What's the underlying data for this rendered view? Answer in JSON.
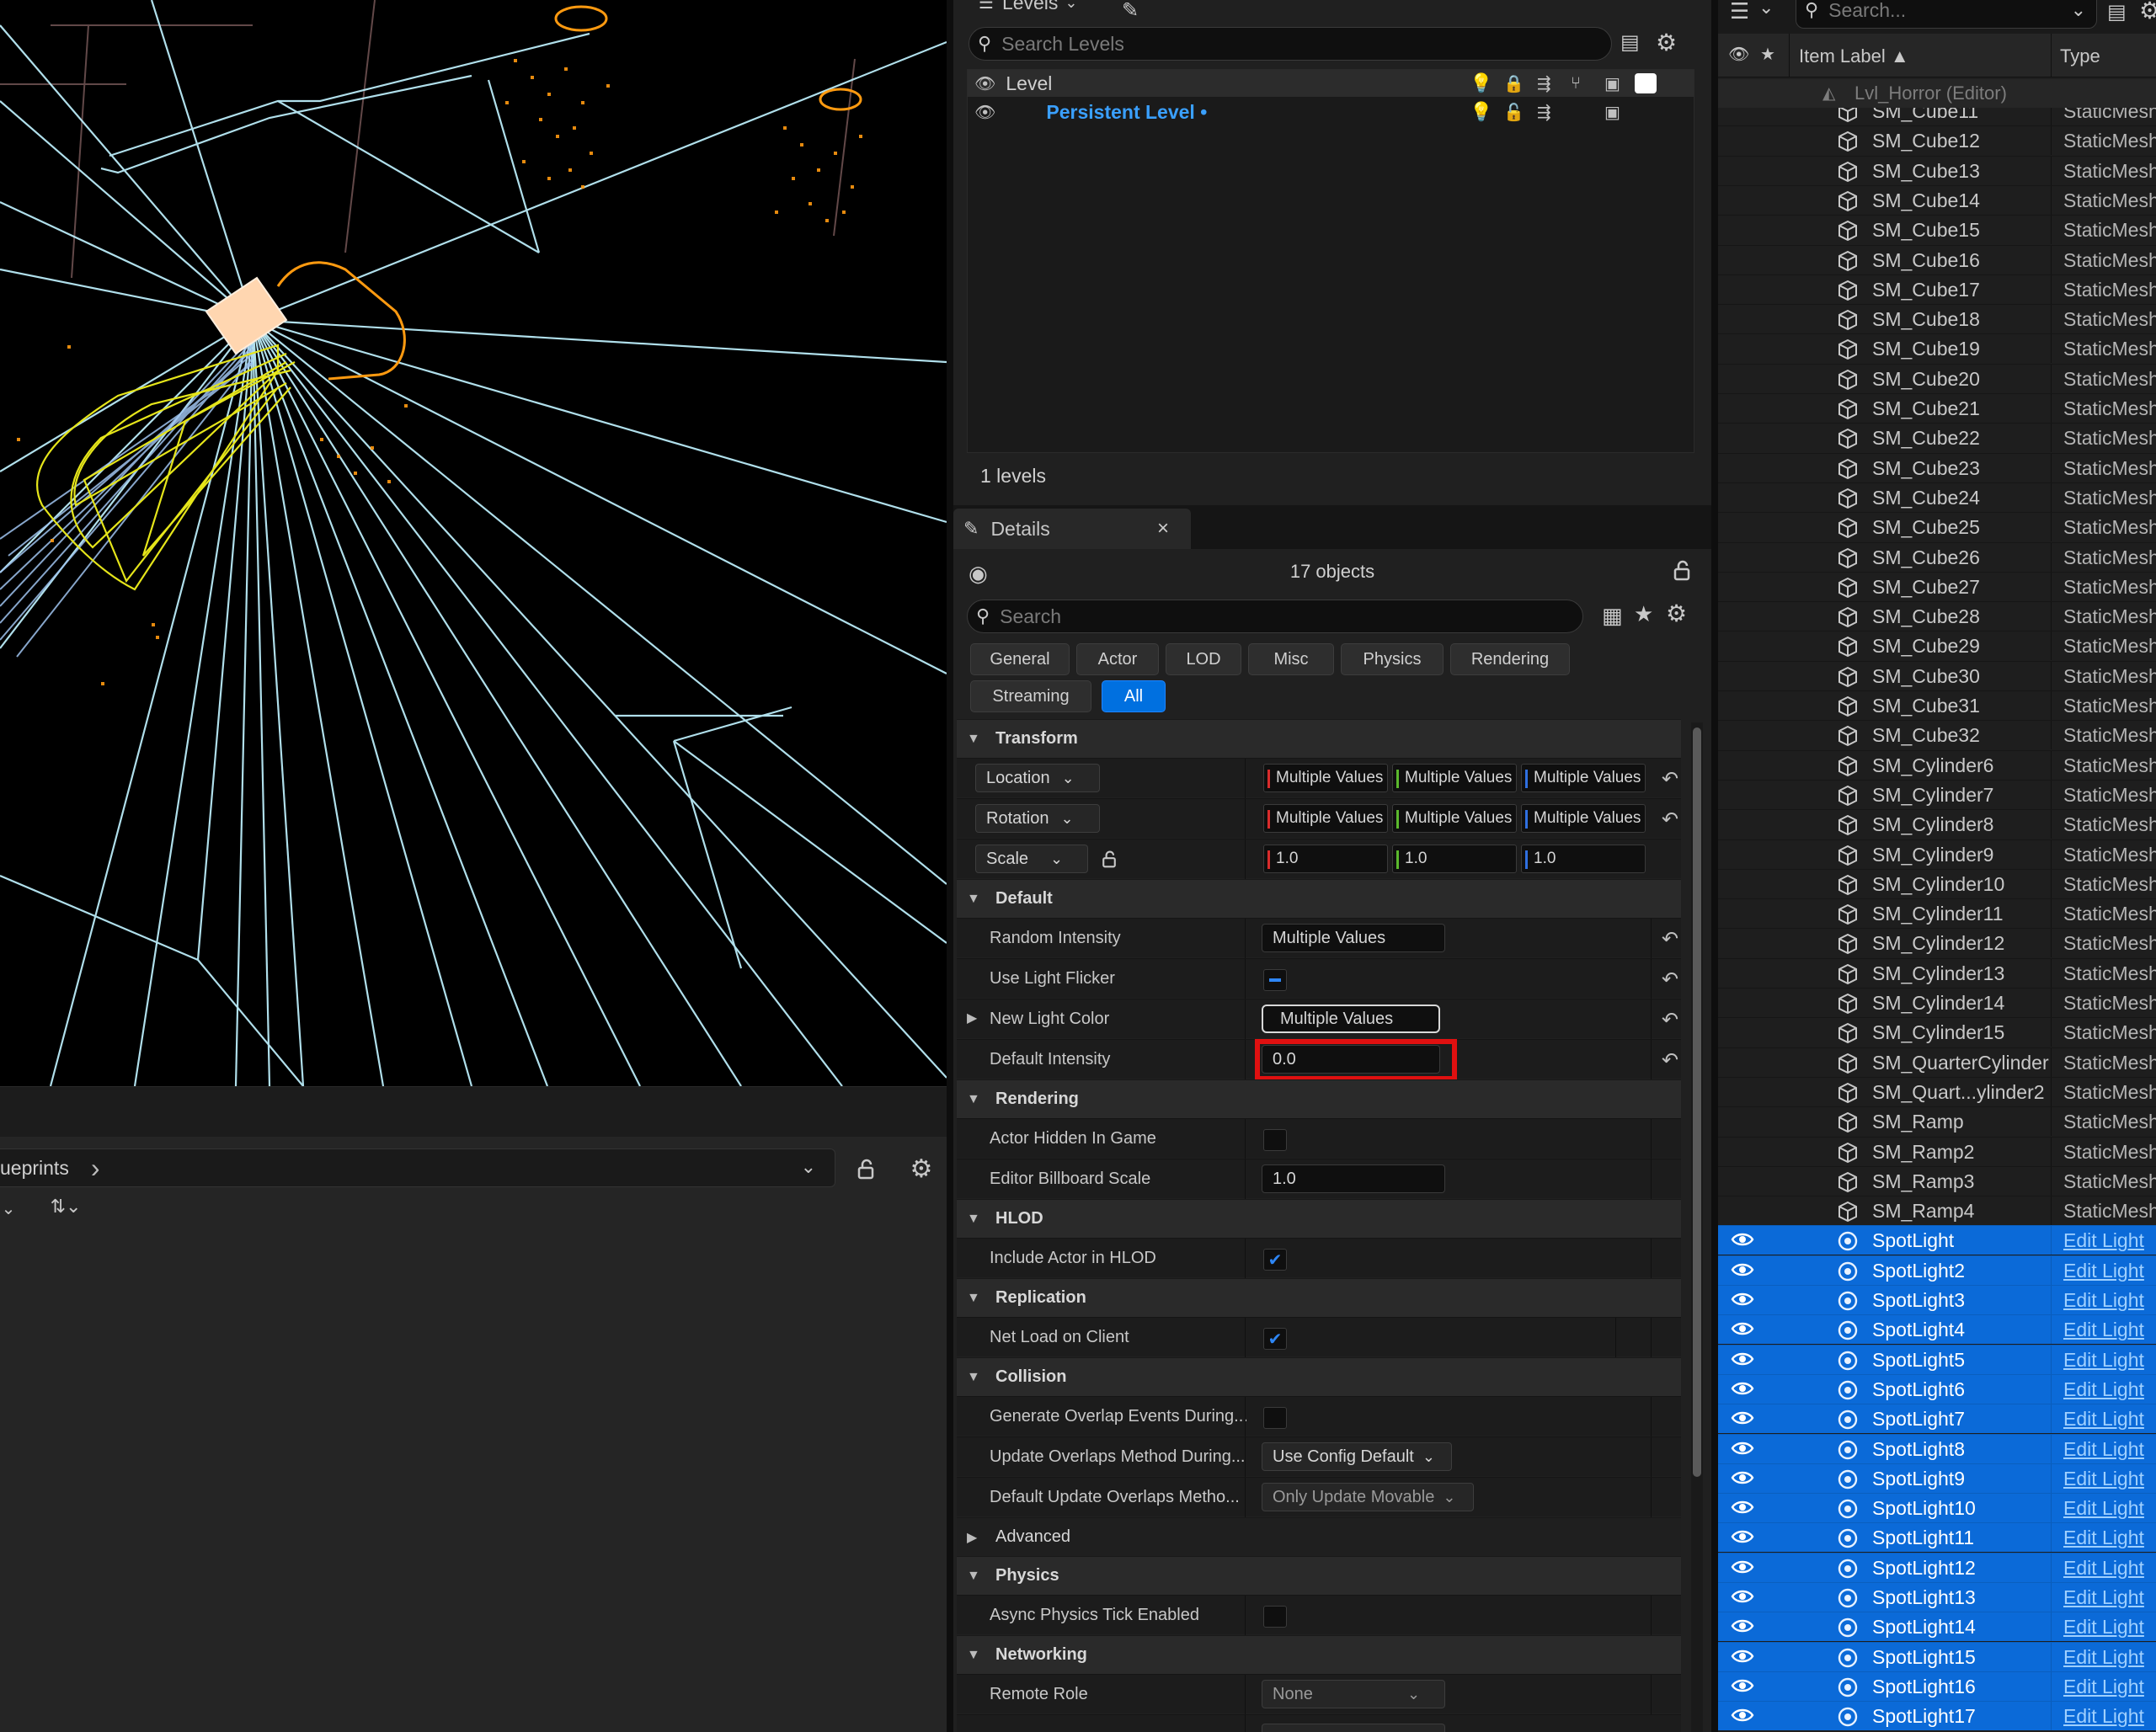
{
  "viewport": {
    "name": "3D viewport (wireframe lights)"
  },
  "content_browser": {
    "path_label": "ueprints",
    "path_chevron": "›"
  },
  "levels": {
    "tab_label": "Levels",
    "search_placeholder": "Search Levels",
    "column_label": "Level",
    "persistent_level": "Persistent Level •",
    "count": "1 levels"
  },
  "details": {
    "tab_label": "Details",
    "close_glyph": "×",
    "objects_count": "17 objects",
    "search_placeholder": "Search",
    "filter_tabs": [
      "General",
      "Actor",
      "LOD",
      "Misc",
      "Physics",
      "Rendering",
      "Streaming",
      "All"
    ],
    "active_filter": "All",
    "sections": {
      "transform": "Transform",
      "default": "Default",
      "rendering": "Rendering",
      "hlod": "HLOD",
      "replication": "Replication",
      "collision": "Collision",
      "advanced": "Advanced",
      "physics": "Physics",
      "networking": "Networking"
    },
    "transform": {
      "location_label": "Location",
      "rotation_label": "Rotation",
      "scale_label": "Scale",
      "location": [
        "Multiple Values",
        "Multiple Values",
        "Multiple Values"
      ],
      "rotation": [
        "Multiple Values",
        "Multiple Values",
        "Multiple Values"
      ],
      "scale": [
        "1.0",
        "1.0",
        "1.0"
      ]
    },
    "default": {
      "random_intensity_label": "Random Intensity",
      "random_intensity_value": "Multiple Values",
      "use_light_flicker_label": "Use Light Flicker",
      "new_light_color_label": "New Light Color",
      "new_light_color_value": "Multiple Values",
      "default_intensity_label": "Default Intensity",
      "default_intensity_value": "0.0"
    },
    "rendering": {
      "actor_hidden_label": "Actor Hidden In Game",
      "billboard_scale_label": "Editor Billboard Scale",
      "billboard_scale_value": "1.0"
    },
    "hlod": {
      "include_label": "Include Actor in HLOD"
    },
    "replication": {
      "net_load_label": "Net Load on Client"
    },
    "collision": {
      "generate_overlap_label": "Generate Overlap Events During...",
      "update_overlaps_label": "Update Overlaps Method During...",
      "update_overlaps_value": "Use Config Default",
      "default_update_label": "Default Update Overlaps Metho...",
      "default_update_value": "Only Update Movable"
    },
    "physics": {
      "async_tick_label": "Async Physics Tick Enabled"
    },
    "networking": {
      "remote_role_label": "Remote Role",
      "remote_role_value": "None"
    }
  },
  "outliner": {
    "search_placeholder": "Search...",
    "col_label": "Item Label ▲",
    "col_type": "Type",
    "root_item": "Lvl_Horror (Editor)",
    "rows": [
      {
        "name": "SM_Cube11",
        "type": "StaticMesh"
      },
      {
        "name": "SM_Cube12",
        "type": "StaticMesh"
      },
      {
        "name": "SM_Cube13",
        "type": "StaticMesh"
      },
      {
        "name": "SM_Cube14",
        "type": "StaticMesh"
      },
      {
        "name": "SM_Cube15",
        "type": "StaticMesh"
      },
      {
        "name": "SM_Cube16",
        "type": "StaticMesh"
      },
      {
        "name": "SM_Cube17",
        "type": "StaticMesh"
      },
      {
        "name": "SM_Cube18",
        "type": "StaticMesh"
      },
      {
        "name": "SM_Cube19",
        "type": "StaticMesh"
      },
      {
        "name": "SM_Cube20",
        "type": "StaticMesh"
      },
      {
        "name": "SM_Cube21",
        "type": "StaticMesh"
      },
      {
        "name": "SM_Cube22",
        "type": "StaticMesh"
      },
      {
        "name": "SM_Cube23",
        "type": "StaticMesh"
      },
      {
        "name": "SM_Cube24",
        "type": "StaticMesh"
      },
      {
        "name": "SM_Cube25",
        "type": "StaticMesh"
      },
      {
        "name": "SM_Cube26",
        "type": "StaticMesh"
      },
      {
        "name": "SM_Cube27",
        "type": "StaticMesh"
      },
      {
        "name": "SM_Cube28",
        "type": "StaticMesh"
      },
      {
        "name": "SM_Cube29",
        "type": "StaticMesh"
      },
      {
        "name": "SM_Cube30",
        "type": "StaticMesh"
      },
      {
        "name": "SM_Cube31",
        "type": "StaticMesh"
      },
      {
        "name": "SM_Cube32",
        "type": "StaticMesh"
      },
      {
        "name": "SM_Cylinder6",
        "type": "StaticMesh"
      },
      {
        "name": "SM_Cylinder7",
        "type": "StaticMesh"
      },
      {
        "name": "SM_Cylinder8",
        "type": "StaticMesh"
      },
      {
        "name": "SM_Cylinder9",
        "type": "StaticMesh"
      },
      {
        "name": "SM_Cylinder10",
        "type": "StaticMesh"
      },
      {
        "name": "SM_Cylinder11",
        "type": "StaticMesh"
      },
      {
        "name": "SM_Cylinder12",
        "type": "StaticMesh"
      },
      {
        "name": "SM_Cylinder13",
        "type": "StaticMesh"
      },
      {
        "name": "SM_Cylinder14",
        "type": "StaticMesh"
      },
      {
        "name": "SM_Cylinder15",
        "type": "StaticMesh"
      },
      {
        "name": "SM_QuarterCylinder",
        "type": "StaticMesh"
      },
      {
        "name": "SM_Quart...ylinder2",
        "type": "StaticMesh"
      },
      {
        "name": "SM_Ramp",
        "type": "StaticMesh"
      },
      {
        "name": "SM_Ramp2",
        "type": "StaticMesh"
      },
      {
        "name": "SM_Ramp3",
        "type": "StaticMesh"
      },
      {
        "name": "SM_Ramp4",
        "type": "StaticMesh"
      },
      {
        "name": "SpotLight",
        "type": "Edit Light",
        "selected": true
      },
      {
        "name": "SpotLight2",
        "type": "Edit Light",
        "selected": true
      },
      {
        "name": "SpotLight3",
        "type": "Edit Light",
        "selected": true
      },
      {
        "name": "SpotLight4",
        "type": "Edit Light",
        "selected": true
      },
      {
        "name": "SpotLight5",
        "type": "Edit Light",
        "selected": true
      },
      {
        "name": "SpotLight6",
        "type": "Edit Light",
        "selected": true
      },
      {
        "name": "SpotLight7",
        "type": "Edit Light",
        "selected": true
      },
      {
        "name": "SpotLight8",
        "type": "Edit Light",
        "selected": true
      },
      {
        "name": "SpotLight9",
        "type": "Edit Light",
        "selected": true
      },
      {
        "name": "SpotLight10",
        "type": "Edit Light",
        "selected": true
      },
      {
        "name": "SpotLight11",
        "type": "Edit Light",
        "selected": true
      },
      {
        "name": "SpotLight12",
        "type": "Edit Light",
        "selected": true
      },
      {
        "name": "SpotLight13",
        "type": "Edit Light",
        "selected": true
      },
      {
        "name": "SpotLight14",
        "type": "Edit Light",
        "selected": true
      },
      {
        "name": "SpotLight15",
        "type": "Edit Light",
        "selected": true
      },
      {
        "name": "SpotLight16",
        "type": "Edit Light",
        "selected": true
      },
      {
        "name": "SpotLight17",
        "type": "Edit Light",
        "selected": true
      }
    ]
  },
  "colors": {
    "accent": "#0070e0",
    "selection": "#0b6ad8",
    "highlight_box": "#e01010",
    "wire_cyan": "#bff2ff",
    "wire_yellow": "#e5e51a",
    "wire_orange": "#ff9a10"
  }
}
